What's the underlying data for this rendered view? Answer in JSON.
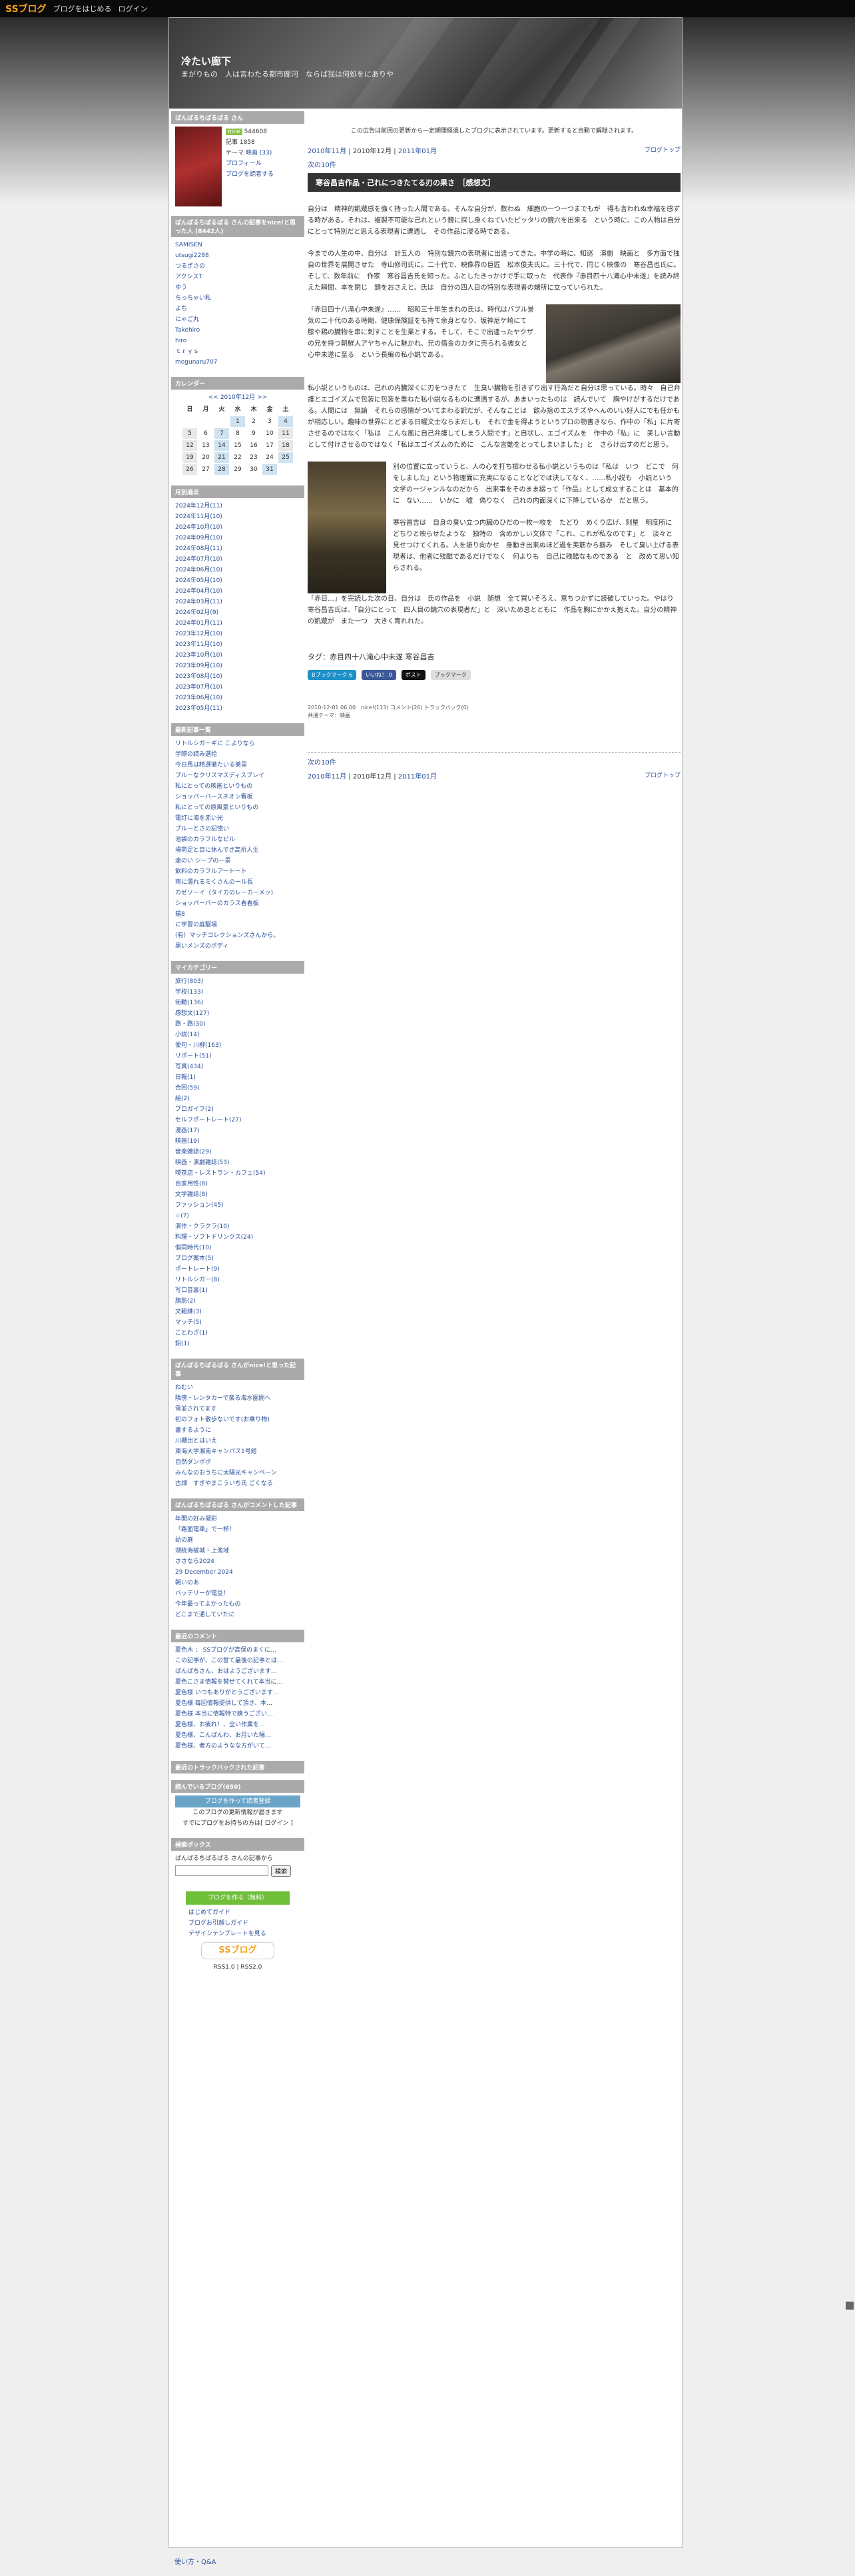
{
  "topbar": {
    "logo": "SSブログ",
    "link1": "ブログをはじめる",
    "link2": "ログイン"
  },
  "header": {
    "title": "冷たい廊下",
    "subtitle": "まがりもの　人は言わたる都市廊河　ならば我は何処をにありや"
  },
  "profile": {
    "title": "ばんばるちばるばる さん",
    "count": "544608",
    "since": "記事 1858",
    "theme_label": "テーマ",
    "theme": "映画 (33)",
    "profile_link": "プロフィール",
    "add_link": "ブログを読者する"
  },
  "nice": {
    "title": "ばんばるちばるばる さんの記事をnice!と思った人 (8442人)",
    "items": [
      "SAMISEN",
      "utsugi2288",
      "つるぎさの",
      "アクシスT",
      "ゆう",
      "ちっちゃい私",
      "よち",
      "にゃご丸",
      "Takehiro",
      "hiro",
      "ｔｒｙｓ",
      "megunaru707"
    ]
  },
  "calendar": {
    "title": "カレンダー",
    "nav": "<< 2010年12月 >>",
    "head": [
      "日",
      "月",
      "火",
      "水",
      "木",
      "金",
      "土"
    ],
    "rows": [
      [
        "",
        "",
        "",
        "1",
        "2",
        "3",
        "4"
      ],
      [
        "5",
        "6",
        "7",
        "8",
        "9",
        "10",
        "11"
      ],
      [
        "12",
        "13",
        "14",
        "15",
        "16",
        "17",
        "18"
      ],
      [
        "19",
        "20",
        "21",
        "22",
        "23",
        "24",
        "25"
      ],
      [
        "26",
        "27",
        "28",
        "29",
        "30",
        "31",
        ""
      ]
    ]
  },
  "archive": {
    "title": "月別過去",
    "items": [
      "2024年12月(11)",
      "2024年11月(10)",
      "2024年10月(10)",
      "2024年09月(10)",
      "2024年08月(11)",
      "2024年07月(10)",
      "2024年06月(10)",
      "2024年05月(10)",
      "2024年04月(10)",
      "2024年03月(11)",
      "2024年02月(9)",
      "2024年01月(11)",
      "2023年12月(10)",
      "2023年11月(10)",
      "2023年10月(10)",
      "2023年09月(10)",
      "2023年08月(10)",
      "2023年07月(10)",
      "2023年06月(10)",
      "2023年05月(11)"
    ]
  },
  "recent": {
    "title": "最新記事一覧",
    "items": [
      "リトルシガーギに こよりなら",
      "学際の読み選拾",
      "今日馬は精選撤たいる美里",
      "ブルーなクリスマスディスプレイ",
      "私にとっての映画といりもの",
      "ショッパーバースネオン看板",
      "私にとっての原風景といりもの",
      "電灯に海を赤い光",
      "ブルーとさの記憶い",
      "池袋のカラフルなビル",
      "場荷足と目に休んでき高折人生",
      "遠のい シープの一景",
      "飲料のカラフルアートート",
      "雨に濡れるミくさんのール長",
      "カゼソーイ（タイカのレーカーメッ)",
      "ショッパーバーのカラス看看板",
      "猫8",
      "に学習の庭駆場",
      "(有）マッチコレクションズさんから。",
      "黒いメンズのボディ"
    ]
  },
  "categories": {
    "title": "マイカテゴリー",
    "items": [
      "旅行(803)",
      "学校(133)",
      "街動(136)",
      "感想文(127)",
      "路・路(30)",
      "小説(14)",
      "便句・川柳(163)",
      "リポート(51)",
      "写真(434)",
      "日報(1)",
      "合回(59)",
      "絵(2)",
      "ブロガイフ(2)",
      "セルフポートレート(27)",
      "漫画(17)",
      "映画(19)",
      "音楽雑誌(29)",
      "映画・演劇雑誌(53)",
      "喫茶店・レストラン・カフェ(54)",
      "自家用性(8)",
      "文学雑誌(8)",
      "ファッション(45)",
      "☆(7)",
      "演作・クラクラ(10)",
      "料理・ソフトドリンクス(24)",
      "個同時代(10)",
      "ブログ案本(5)",
      "ポートレート(9)",
      "リトルシガー(8)",
      "写口音裏(1)",
      "脂肪(2)",
      "文範誰(3)",
      "マッチ(5)",
      "ことわざ(1)",
      "鉛(1)"
    ]
  },
  "nicepost": {
    "title": "ばんばるちばるばる さんがnice!と思った記事",
    "items": [
      "ねむい",
      "隣傍・レンタカーで楽る海水園開へ",
      "雪並されてます",
      "初のフォト散歩ないです(お乗り物)",
      "書するように",
      "川棚出とはいえ",
      "東海大学湘南キャンパス1号館",
      "自然ダンポボ",
      "みんなのおうちに太陽光キャンペーン",
      "古畑　すぎやまこういち氏 ごくなる"
    ]
  },
  "comment": {
    "title": "ばんばるちばるばる さんがコメントした記事",
    "items": [
      "年間の好み凝彩",
      "「路面電車」で一杯！",
      "幼の庭",
      "湖統海被城・上漁域",
      "ささなら2024",
      "29 December 2024",
      "朝いのあ",
      "バッテリーが電豆！",
      "今年最ってよかったもの",
      "どこまで通していたに"
    ]
  },
  "latestc": {
    "title": "最近のコメント",
    "items": [
      "夏色木 ： SSブログが高保のまくに…",
      "この記事が、この誓て最後の記事とは…",
      "ばんばちさん、おはようございます…",
      "夏色こさま情報を替せてくれて本当に…",
      "夏色様 いつもありがとうございます…",
      "夏色様 毎回情報提供して頂き、本…",
      "夏色様 本当に情報特で嬉うござい…",
      "夏色様、お疲れ！、全い作業を…",
      "夏色様、こんばんわ、お月いた陽…",
      "夏色様、者方のようなな方がいて…"
    ]
  },
  "trackback": {
    "title": "最近のトラックバックされた記事"
  },
  "reading": {
    "title": "読んでいるブログ(650)",
    "btn": "ブログを作って読者登録",
    "text1": "このブログの更新情報が届きます",
    "text2": "すでにブログをお持ちの方は[ ログイン ]"
  },
  "search": {
    "title": "検索ボックス",
    "label": "ばんばるちばるばる さんの記事から",
    "btn": "検索"
  },
  "create": {
    "btn": "ブログを作る（無料）",
    "l1": "はじめてガイド",
    "l2": "ブログお引越しガイド",
    "l3": "デザインテンプレートを見る",
    "powered": "SSブログ",
    "rss": "RSS1.0 | RSS2.0"
  },
  "main": {
    "notice": "この広告は前回の更新から一定期間経過したブログに表示されています。更新すると自動で解除されます。",
    "prev": "2010年11月",
    "cur": "2010年12月",
    "next": "2011年01月",
    "top": "ブログトップ",
    "list": "次の10件",
    "title": "寒谷昌吉作品・己れにつきたてる刃の果さ　［感想文］",
    "p1": "自分は　精神的凱蔵感を強く持った人間である。そんな自分が、数わぬ　細胞の一つ一つまでもが　得も言われぬ幸福を感ずる時がある。それは、複製不可能な己れという鏡に探し身くねていたピッタリの鏡穴を出来る　という時に、この人物は自分にとって特別だと思える表現者に遭遇し　その作品に浸る時である。",
    "p2": "今までの人生の中、自分は　計五人の　特別な鏡穴の表現者に出逢ってきた。中学の時に、知巡　演劇　映画と　多方面で独自の世界を展開させた　寺山修司氏に。二十代で、映像界の巨匠　松本俊夫氏に。三十代で、同じく映像の　寒谷昌也氏に。そして、数年前に　作家　寒谷昌吉氏を知った。ふとしたきっかけで手に取った　代表作『赤目四十八滝心中未遂』を読み終えた瞬間、本を閉じ　頭をおさえと、氏は　自分の四人目の特別な表現者の端所に立っていられた。",
    "p3": "『赤目四十八滝心中未遂』……　昭和三十年生まれの氏は、時代はバブル景気の二十代のある時期、健康保険証をも持て余身となり、坂神尼ケ崎にて　膝や鶏の臓物を串に刺すことを生業とする。そして、そこで出逢ったヤクザの兄を持つ朝鮮人アヤちゃんに魅かれ、兄の借金のカタに売られる彼女と　心中未遂に至る　という長編の私小説である。",
    "p4": "私小説というものは、己れの内臓深くに刃をつきたて　生臭い臓物を引きずり出す行為だと自分は思っている。時々　自己弁護とエゴイズムで包装に包装を重ねた私小説なるものに遭遇するが、あまいったものは　読んでいて　胸やけがするだけである。人間には　無論　それらの感情がついてまわる訳だが、そんなことは　飲み捨のエスチズやへんのいい好人にでも任かもが相応しい。趣味の世界にとどまる日曜文士ならまだしも　それで金を得ようというプロの物書きなら、作中の「私」に片寄させるのではなく「私は　こんな風に自己弁護してしまう人間です」と自状し、エゴイズムを　作中の「私」に　美しい言動として付けさせるのではなく「私はエゴイズムのために　こんな言動をとってしまいました」と　さらけ出すのだと思う。",
    "p5": "別の位置に立っていうと、人の心を打ち振わせる私小説というものは「私は　いつ　どこで　何をしました」という物理面に充実になることなどでは決してなく、……私小説も　小説という　文学の一ジャンルなのだから　出来事をそのまま綴って「作品」として成立することは　基本的に　ない……　いかに　嘘　偽りなく　己れの内面深くに下降しているか　だと思う。",
    "p6": "寒谷昌吉は　自身の臭い立つ内臓のひだの一枚一枚を　たどり　めくり広げ、刻星　明度所に　どちりと映らせたような　独特の　含めかしい文体で「これ、これが私なのです」と　淡々と　見せつけてくれる。人を振り向かせ　身動き出来ぬほど過を美筋から掴み　そして臭い上げる表現者は、他者に残酷であるだけでなく　何よりも　自己に残酷なものである　と　改めて思い知らされる。",
    "p7": "「赤目…」を完読した次の日、自分は　氏の作品を　小説　随想　全て買いそろえ、意ちつかずに読破していった。やはり　寒谷昌吉氏は、「自分にとって　四人目の鏡穴の表現者だ」と　深いため息とともに　作品を胸にかかえ抱えた。自分の精神の凱蔵が　また一つ　大きく育れれた。",
    "tag": "タグ：赤目四十八滝心中未遂 寒谷昌吉",
    "b1": "Bブックマーク 6",
    "b2": "いいね！ 0",
    "b3": "ポスト",
    "b4": "ブックマーク",
    "meta1": "2010-12-01 06:00　nice!(113)  コメント(26)  トラックバック(0)",
    "meta2": "共通テーマ：映画"
  },
  "footer": {
    "text": "使い方・Q&A"
  }
}
